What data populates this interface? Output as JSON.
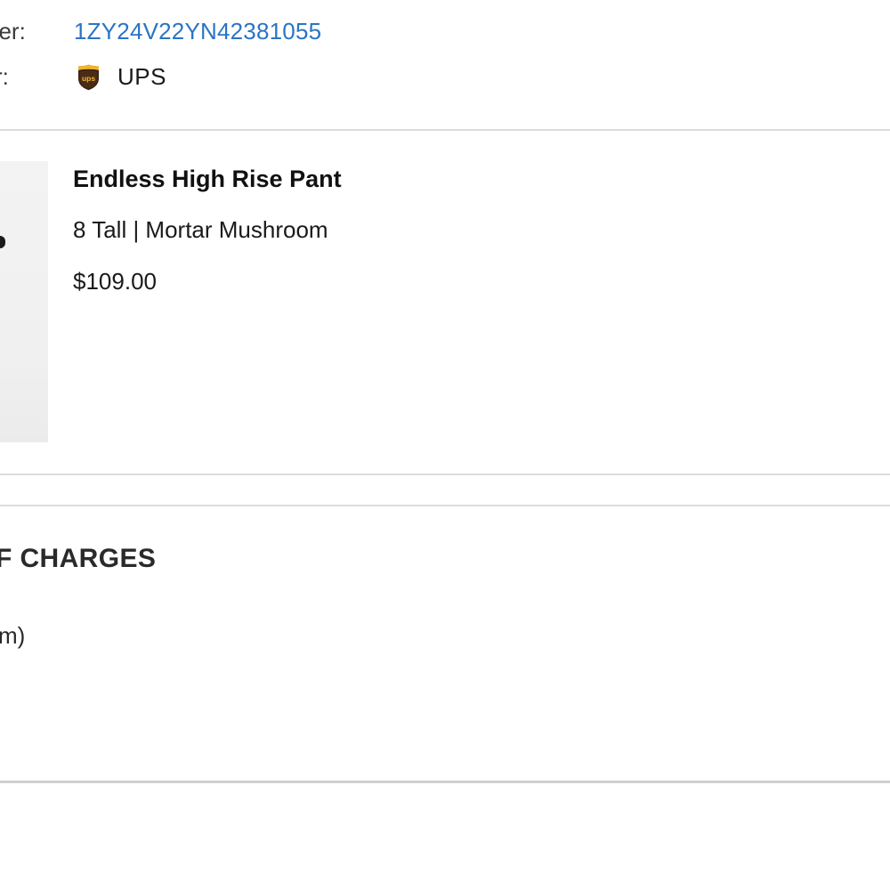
{
  "shipment": {
    "tracking_label_partial": "ber:",
    "tracking_number": "1ZY24V22YN42381055",
    "carrier_label_partial": "r:",
    "carrier_name": "UPS",
    "carrier_logo_icon": "ups-logo-icon",
    "carrier_logo_text": "ups",
    "link_color": "#2a74c4"
  },
  "product": {
    "image_icon": "product-thumbnail",
    "name": "Endless High Rise Pant",
    "variant": "8 Tall | Mortar Mushroom",
    "price": "$109.00"
  },
  "charges": {
    "heading_partial": "F CHARGES",
    "line_partial": "m)"
  }
}
